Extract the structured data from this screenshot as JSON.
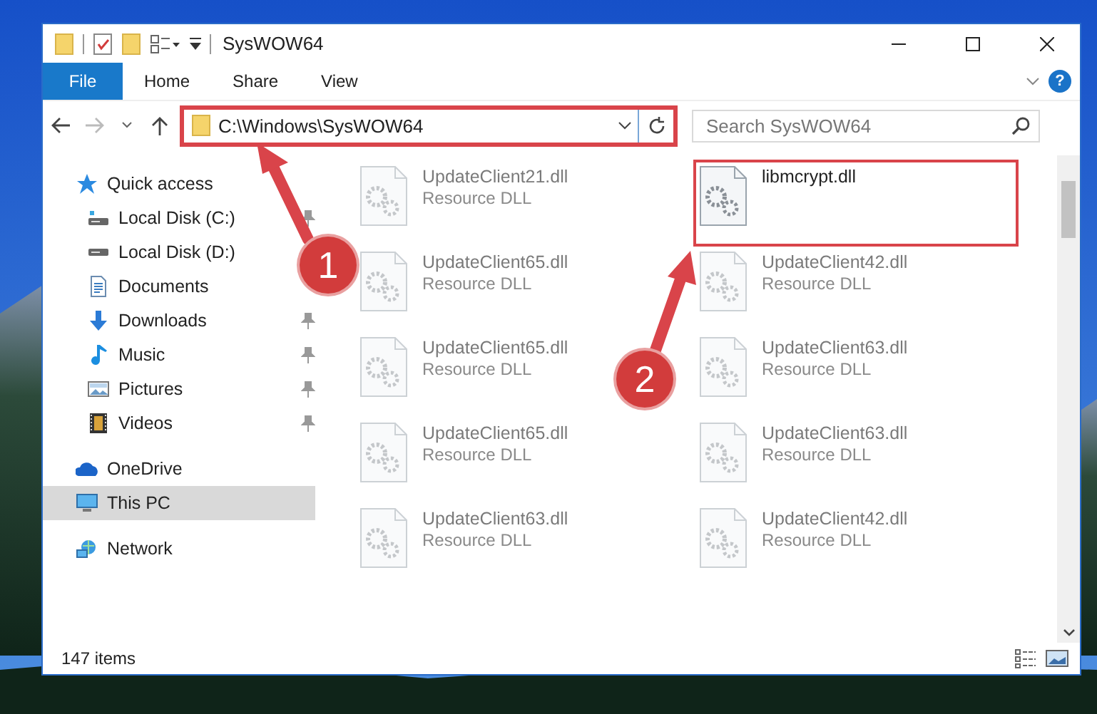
{
  "window": {
    "title": "SysWOW64"
  },
  "ribbon": {
    "tabs": [
      {
        "label": "File",
        "kind": "file",
        "selected": false
      },
      {
        "label": "Home",
        "kind": "tab",
        "selected": false
      },
      {
        "label": "Share",
        "kind": "tab",
        "selected": false
      },
      {
        "label": "View",
        "kind": "tab",
        "selected": false
      }
    ],
    "help_button": "?"
  },
  "address_bar": {
    "path": "C:\\Windows\\SysWOW64",
    "highlighted": true
  },
  "search": {
    "placeholder": "Search SysWOW64"
  },
  "sidebar": {
    "items": [
      {
        "label": "Quick access",
        "selected": false,
        "children": [
          {
            "label": "Local Disk (C:)",
            "pinned": true,
            "selected": false
          },
          {
            "label": "Local Disk (D:)",
            "pinned": false,
            "selected": false
          },
          {
            "label": "Documents",
            "pinned": false,
            "selected": false
          },
          {
            "label": "Downloads",
            "pinned": true,
            "selected": false
          },
          {
            "label": "Music",
            "pinned": true,
            "selected": false
          },
          {
            "label": "Pictures",
            "pinned": true,
            "selected": false
          },
          {
            "label": "Videos",
            "pinned": true,
            "selected": false
          }
        ]
      },
      {
        "label": "OneDrive",
        "selected": false
      },
      {
        "label": "This PC",
        "selected": true
      },
      {
        "label": "Network",
        "selected": false
      }
    ]
  },
  "files": [
    {
      "name": "UpdateClient21.dll",
      "type": "Resource DLL",
      "dimmed": true,
      "highlighted": false
    },
    {
      "name": "libmcrypt.dll",
      "dimmed": false,
      "highlighted": true
    },
    {
      "name": "UpdateClient65.dll",
      "type": "Resource DLL",
      "dimmed": true,
      "highlighted": false
    },
    {
      "name": "UpdateClient42.dll",
      "type": "Resource DLL",
      "dimmed": true,
      "highlighted": false
    },
    {
      "name": "UpdateClient65.dll",
      "type": "Resource DLL",
      "dimmed": true,
      "highlighted": false
    },
    {
      "name": "UpdateClient63.dll",
      "type": "Resource DLL",
      "dimmed": true,
      "highlighted": false
    },
    {
      "name": "UpdateClient65.dll",
      "type": "Resource DLL",
      "dimmed": true,
      "highlighted": false
    },
    {
      "name": "UpdateClient63.dll",
      "type": "Resource DLL",
      "dimmed": true,
      "highlighted": false
    },
    {
      "name": "UpdateClient63.dll",
      "type": "Resource DLL",
      "dimmed": true,
      "highlighted": false
    },
    {
      "name": "UpdateClient42.dll",
      "type": "Resource DLL",
      "dimmed": true,
      "highlighted": false
    }
  ],
  "status_bar": {
    "item_count": "147 items"
  },
  "annotations": [
    {
      "label": "1"
    },
    {
      "label": "2"
    }
  ]
}
